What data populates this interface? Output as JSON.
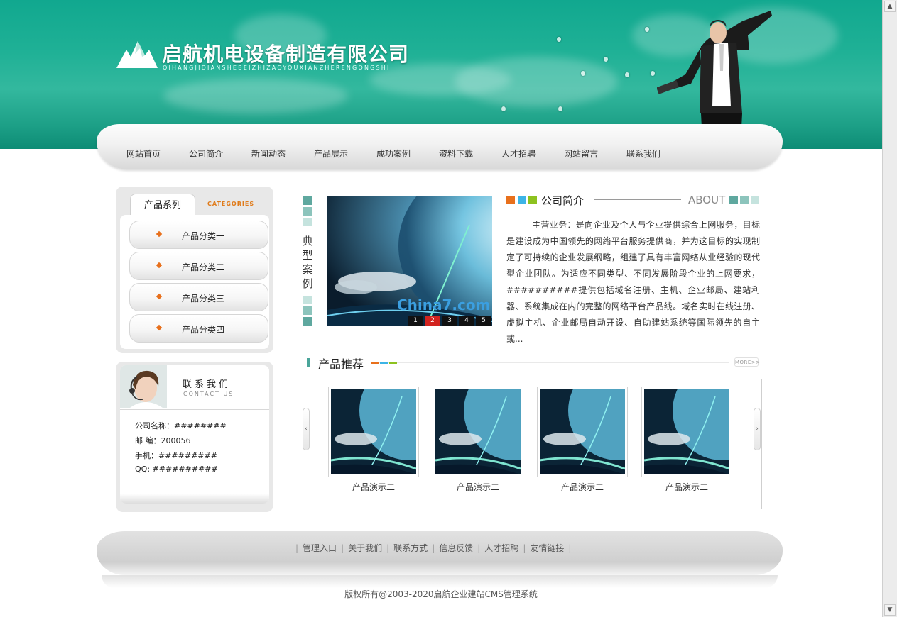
{
  "header": {
    "company_name": "启航机电设备制造有限公司",
    "company_pinyin": "QIHANGJIDIANSHEBEIZHIZAOYOUXIANZHERENGONGSHI"
  },
  "nav": {
    "items": [
      "网站首页",
      "公司简介",
      "新闻动态",
      "产品展示",
      "成功案例",
      "资料下载",
      "人才招聘",
      "网站留言",
      "联系我们"
    ]
  },
  "categories": {
    "tab_label": "产品系列",
    "tab_en": "CATEGORIES",
    "items": [
      "产品分类一",
      "产品分类二",
      "产品分类三",
      "产品分类四"
    ]
  },
  "contact": {
    "title": "联系我们",
    "title_en": "CONTACT US",
    "lines": [
      "公司名称：########",
      "邮  编：200056",
      "手机：#########",
      "QQ: ##########"
    ]
  },
  "case": {
    "title": "典型案例",
    "watermark": "China7.com",
    "pages": [
      "1",
      "2",
      "3",
      "4",
      "5"
    ],
    "active_page": "2"
  },
  "about": {
    "title": "公司简介",
    "title_en": "ABOUT",
    "text": "主营业务：是向企业及个人与企业提供综合上网服务，目标是建设成为中国领先的网络平台服务提供商，并为这目标的实现制定了可持续的企业发展纲略，组建了具有丰富网络从业经验的现代型企业团队。为适应不同类型、不同发展阶段企业的上网要求，##########提供包括域名注册、主机、企业邮局、建站利器、系统集成在内的完整的网络平台产品线。域名实时在线注册、虚拟主机、企业邮局自动开设、自助建站系统等国际领先的自主或..."
  },
  "products": {
    "title": "产品推荐",
    "more": "MORE>>",
    "items": [
      {
        "caption": "产品演示二"
      },
      {
        "caption": "产品演示二"
      },
      {
        "caption": "产品演示二"
      },
      {
        "caption": "产品演示二"
      }
    ]
  },
  "footer": {
    "links": [
      "管理入口",
      "关于我们",
      "联系方式",
      "信息反馈",
      "人才招聘",
      "友情链接"
    ],
    "copyright": "版权所有@2003-2020启航企业建站CMS管理系统"
  },
  "colors": {
    "header_teal": "#1fb196",
    "accent_orange": "#e8701c",
    "accent_blue": "#3cb4e6",
    "accent_green": "#8dc21f",
    "square_teal": "#4aa59a"
  }
}
